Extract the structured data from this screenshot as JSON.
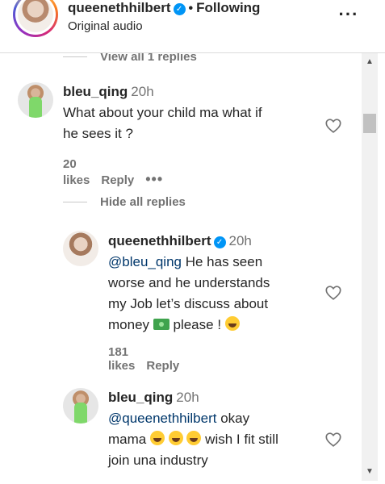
{
  "header": {
    "username": "queenethhilbert",
    "separator": "•",
    "following": "Following",
    "subtitle": "Original audio",
    "verified_icon": "verified-badge-icon",
    "more_icon": "more-horizontal-icon"
  },
  "view_replies": "View all 1 replies",
  "hide_replies": "Hide all replies",
  "comments": [
    {
      "username": "bleu_qing",
      "time": "20h",
      "line1": "What about your child ma what if",
      "line2": "he sees it ?",
      "likes": "20 likes",
      "reply": "Reply",
      "more": "•••"
    },
    {
      "username": "queenethhilbert",
      "time": "20h",
      "mention": "@bleu_qing",
      "line1_rest": " He has seen",
      "line2": "worse and he understands",
      "line3": "my Job let’s discuss about",
      "line4_a": "money",
      "line4_b": "please !",
      "likes": "181 likes",
      "reply": "Reply"
    },
    {
      "username": "bleu_qing",
      "time": "20h",
      "mention": "@queenethhilbert",
      "line1_rest": " okay",
      "line2_a": "mama",
      "line2_b": "wish I fit still",
      "line3": "join una industry"
    }
  ],
  "colors": {
    "link": "#00376b",
    "muted": "#737373",
    "verified": "#0095f6"
  }
}
